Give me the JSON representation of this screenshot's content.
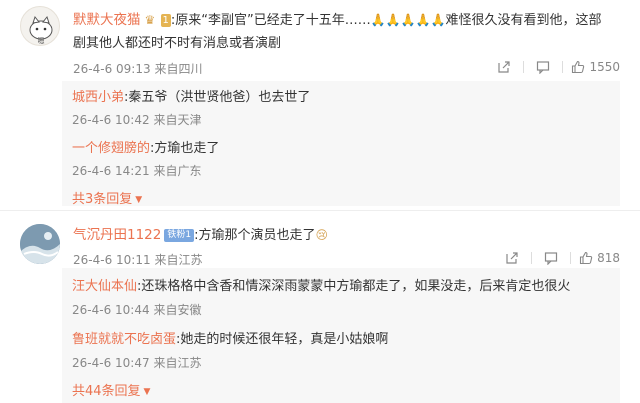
{
  "comments": [
    {
      "user": "默默大夜猫",
      "level_badge": "1",
      "text_part1": ":原来“李副官”已经走了十五年……",
      "emoji_count": "🙏🙏🙏🙏🙏",
      "text_part2": "难怪很久没有看到他，这部",
      "text_line2": "剧其他人都还时不时有消息或者演剧",
      "time": "26-4-6 09:13",
      "source": "来自四川",
      "likes": "1550",
      "replies": [
        {
          "user": "城西小弟",
          "text": ":秦五爷（洪世贤他爸）也去世了",
          "time": "26-4-6 10:42",
          "source": "来自天津"
        },
        {
          "user": "一个修翅膀的",
          "text": ":方瑜也走了",
          "time": "26-4-6 14:21",
          "source": "来自广东"
        }
      ],
      "more_replies": "共3条回复"
    },
    {
      "user": "气沉丹田1122",
      "fans_badge": "铁粉1",
      "text": ":方瑜那个演员也走了",
      "emoji": "😢",
      "time": "26-4-6 10:11",
      "source": "来自江苏",
      "likes": "818",
      "replies": [
        {
          "user": "汪大仙本仙",
          "text": ":还珠格格中含香和情深深雨蒙蒙中方瑜都走了，如果没走，后来肯定也很火",
          "time": "26-4-6 10:44",
          "source": "来自安徽"
        },
        {
          "user": "鲁班就就不吃卤蛋",
          "text": ":她走的时候还很年轻，真是小姑娘啊",
          "time": "26-4-6 10:47",
          "source": "来自江苏"
        }
      ],
      "more_replies": "共44条回复"
    }
  ],
  "icons": {
    "share": "share-icon",
    "comment": "comment-icon",
    "like": "thumbs-up-icon"
  }
}
